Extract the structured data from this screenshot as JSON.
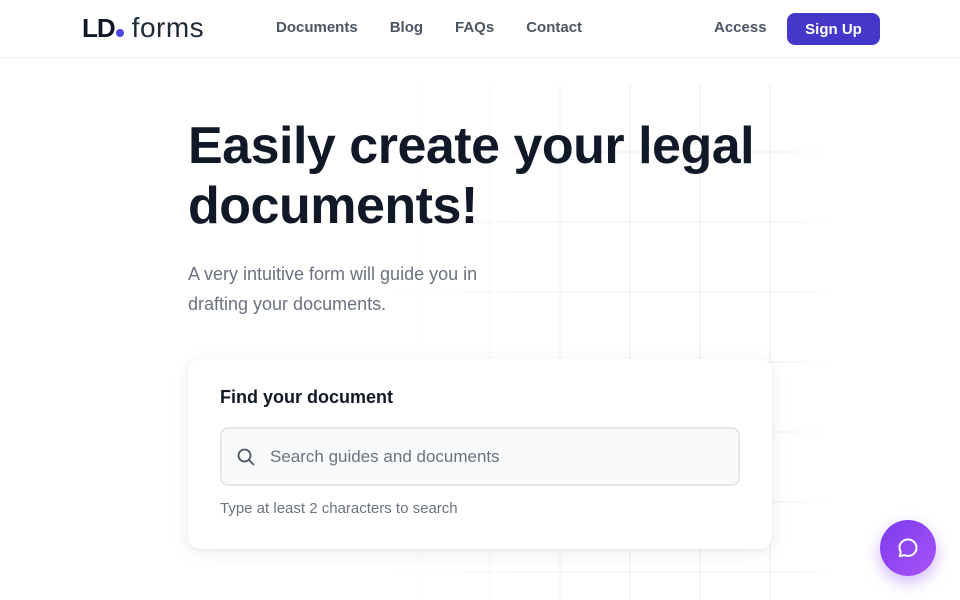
{
  "header": {
    "logo_mark": "LD",
    "logo_word": "forms",
    "nav": [
      "Documents",
      "Blog",
      "FAQs",
      "Contact"
    ],
    "access_label": "Access",
    "signup_label": "Sign Up"
  },
  "hero": {
    "title": "Easily create your legal documents!",
    "subtitle": "A very intuitive form will guide you in drafting your documents."
  },
  "search_card": {
    "title": "Find your document",
    "placeholder": "Search guides and documents",
    "value": "",
    "hint": "Type at least 2 characters to search"
  },
  "icons": {
    "search": "search-icon",
    "chat": "chat-bubble-icon"
  },
  "colors": {
    "brand": "#4338ca",
    "logo_dot": "#4f46e5",
    "chat_gradient_start": "#7c3aed",
    "chat_gradient_end": "#a855f7",
    "text_primary": "#111827",
    "text_secondary": "#6b7280"
  }
}
